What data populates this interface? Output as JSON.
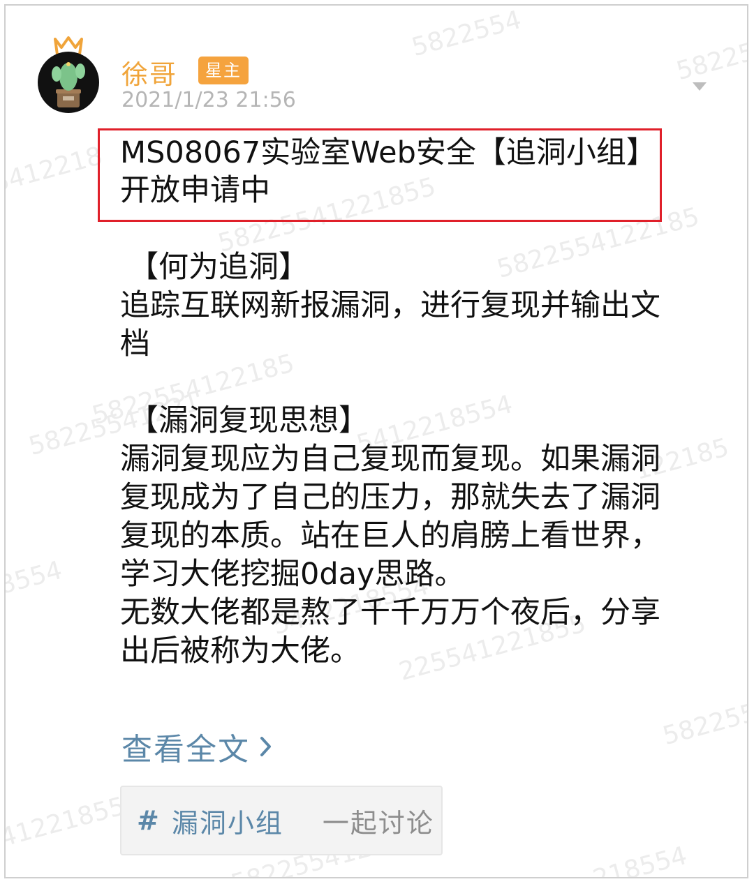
{
  "post": {
    "author_name": "徐哥",
    "author_badge": "星主",
    "timestamp": "2021/1/23 21:56",
    "title": "MS08067实验室Web安全【追洞小组】开放申请中",
    "body": [
      {
        "kind": "heading",
        "text": "【何为追洞】"
      },
      {
        "kind": "text",
        "text": "追踪互联网新报漏洞，进行复现并输出文档"
      },
      {
        "kind": "spacer",
        "text": ""
      },
      {
        "kind": "heading",
        "text": "【漏洞复现思想】"
      },
      {
        "kind": "text",
        "text": "漏洞复现应为自己复现而复现。如果漏洞复现成为了自己的压力，那就失去了漏洞复现的本质。站在巨人的肩膀上看世界，学习大佬挖掘0day思路。"
      },
      {
        "kind": "text",
        "text": "无数大佬都是熬了千千万万个夜后，分享出后被称为大佬。"
      }
    ],
    "read_more": "查看全文",
    "tag": {
      "hash": "#",
      "label": "漏洞小组",
      "action": "一起讨论"
    }
  },
  "watermark_text": "5822554122185547",
  "colors": {
    "author": "#f0a43a",
    "badge_bg": "#f5a33e",
    "link": "#5b87a8",
    "highlight_border": "#e0202a",
    "timestamp": "#b5b5b5"
  }
}
